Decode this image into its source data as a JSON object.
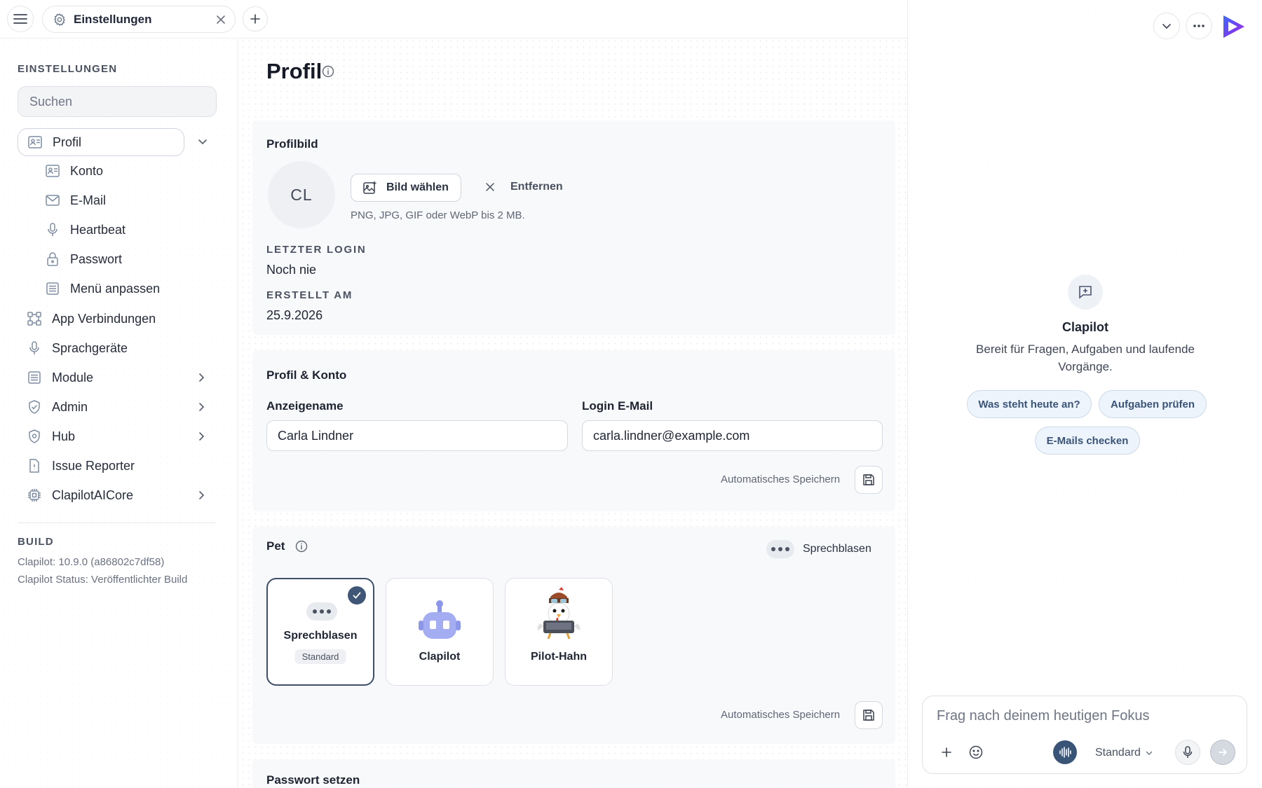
{
  "topbar": {
    "tab_label": "Einstellungen"
  },
  "sidebar": {
    "heading": "EINSTELLUNGEN",
    "search_placeholder": "Suchen",
    "active_item": "Profil",
    "subitems": [
      "Konto",
      "E-Mail",
      "Heartbeat",
      "Passwort",
      "Menü anpassen"
    ],
    "items": [
      "App Verbindungen",
      "Sprachgeräte",
      "Module",
      "Admin",
      "Hub",
      "Issue Reporter",
      "ClapilotAICore"
    ],
    "build_heading": "BUILD",
    "build_version": "Clapilot: 10.9.0 (a86802c7df58)",
    "build_status": "Clapilot Status: Veröffentlichter Build"
  },
  "main": {
    "title": "Profil",
    "profile_picture": {
      "title": "Profilbild",
      "initials": "CL",
      "choose_label": "Bild wählen",
      "remove_label": "Entfernen",
      "hint": "PNG, JPG, GIF oder WebP bis 2 MB."
    },
    "last_login_label": "LETZTER LOGIN",
    "last_login_value": "Noch nie",
    "created_label": "ERSTELLT AM",
    "created_value": "25.9.2026",
    "account": {
      "title": "Profil & Konto",
      "display_name_label": "Anzeigename",
      "display_name_value": "Carla Lindner",
      "email_label": "Login E-Mail",
      "email_value": "carla.lindner@example.com",
      "autosave_label": "Automatisches Speichern"
    },
    "pet": {
      "title": "Pet",
      "toggle_label": "Sprechblasen",
      "options": [
        {
          "name": "Sprechblasen",
          "badge": "Standard"
        },
        {
          "name": "Clapilot"
        },
        {
          "name": "Pilot-Hahn"
        }
      ],
      "autosave_label": "Automatisches Speichern"
    },
    "password_title": "Passwort setzen"
  },
  "assistant": {
    "name": "Clapilot",
    "subtitle": "Bereit für Fragen, Aufgaben und laufende Vorgänge.",
    "chips": [
      "Was steht heute an?",
      "Aufgaben prüfen",
      "E-Mails checken"
    ],
    "composer_placeholder": "Frag nach deinem heutigen Fokus",
    "model_label": "Standard"
  },
  "colors": {
    "accent": "#3f5676",
    "chip_bg": "#eef4fb",
    "voice_button": "#3a5478"
  }
}
